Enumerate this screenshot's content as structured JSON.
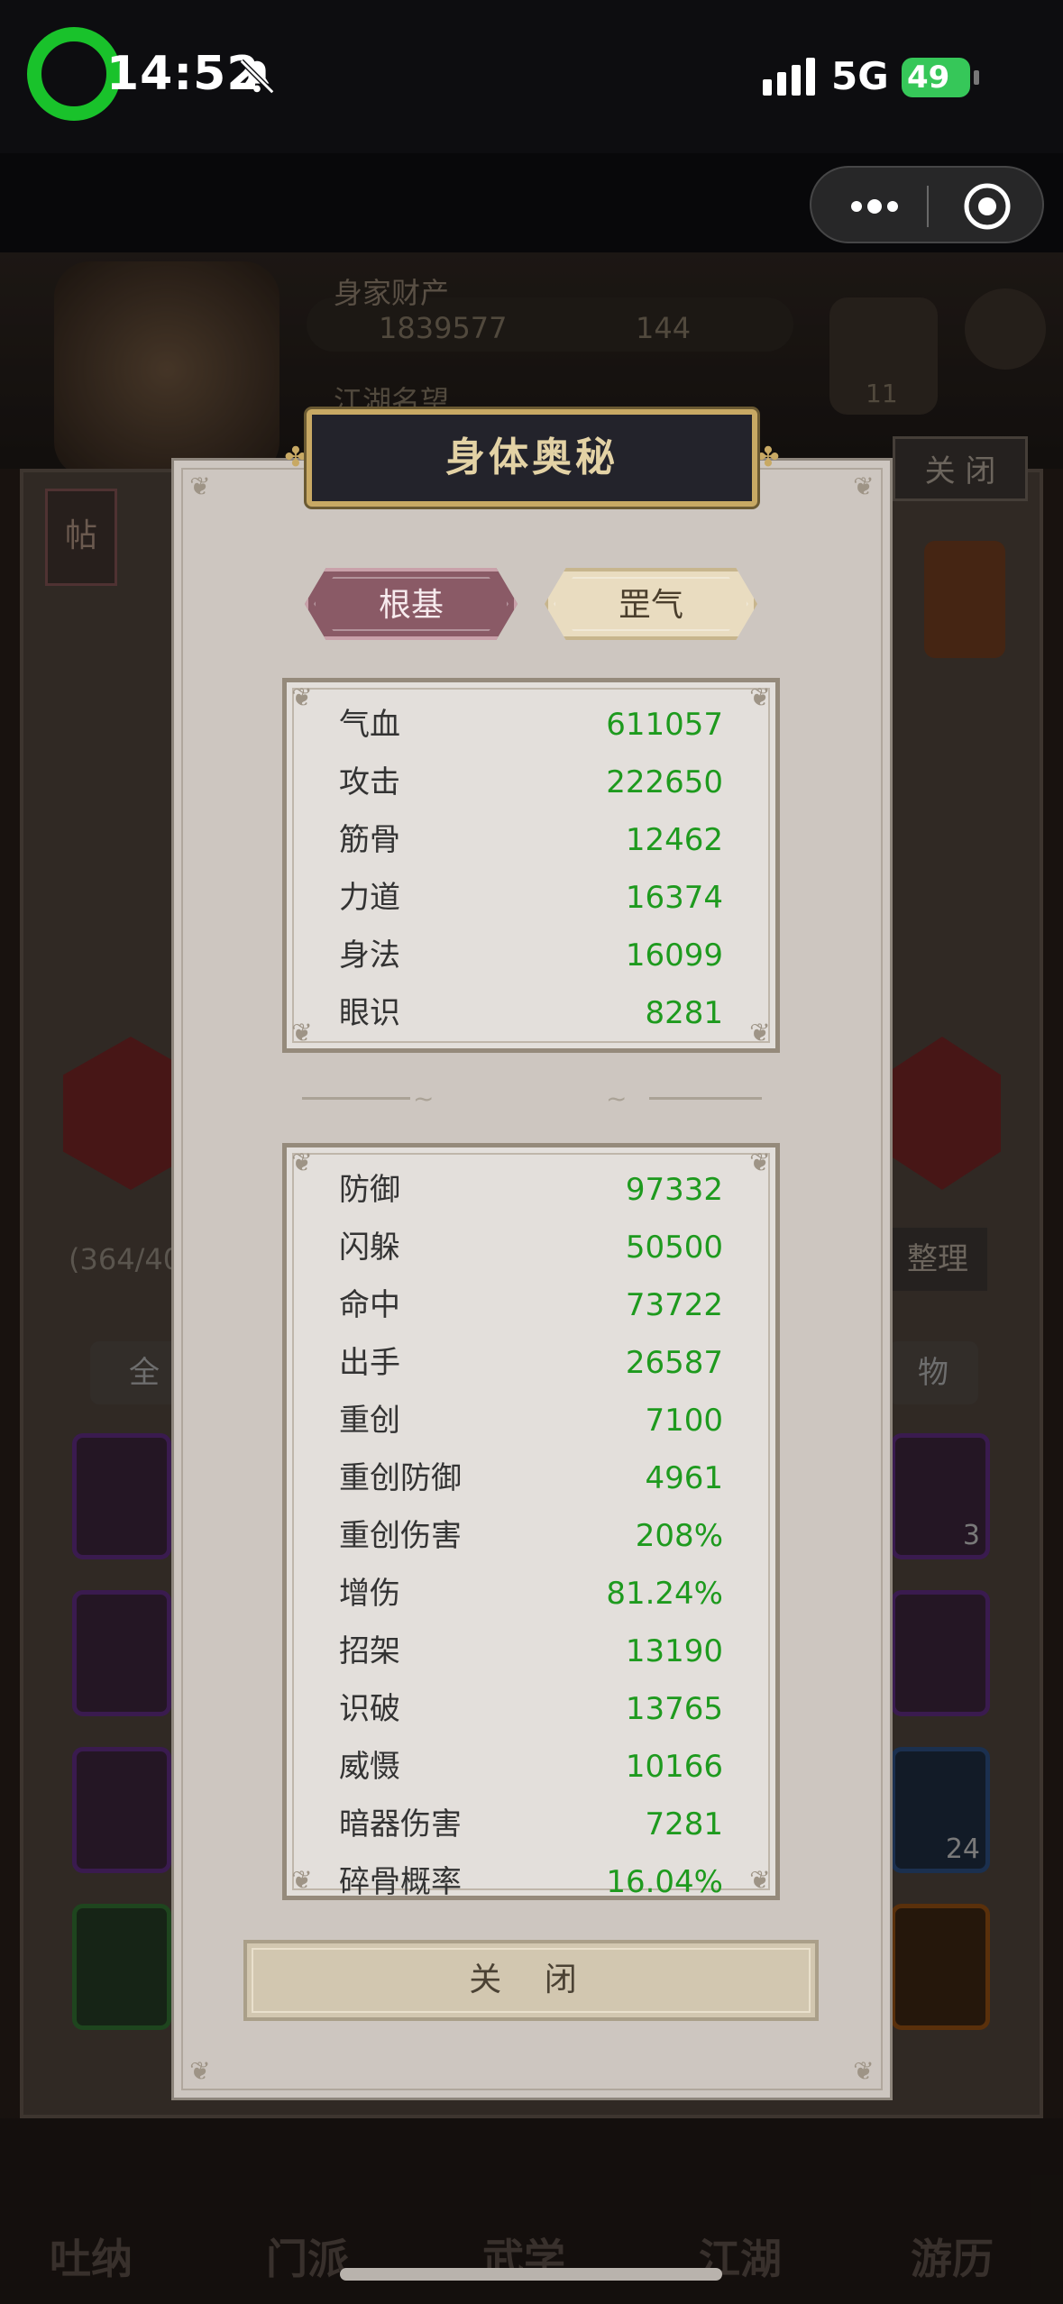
{
  "status_bar": {
    "time": "14:52",
    "network": "5G",
    "battery": "49",
    "icons": [
      "recording-icon",
      "bell-muted-icon",
      "signal-icon",
      "battery-charging-icon"
    ]
  },
  "capsule": {
    "icons": [
      "more-dots-icon",
      "close-target-icon"
    ]
  },
  "background": {
    "wealth_label": "身家财产",
    "gold": "1839577",
    "jade": "144",
    "fame_label": "江湖名望",
    "close_label": "关 闭",
    "post_label": "帖",
    "yinyang_count": "11",
    "inventory_count": "(364/40",
    "tidy_label": "整理",
    "tab_all": "全",
    "tab_items": "物",
    "slot_count_3": "3",
    "slot_count_24": "24",
    "nav": [
      "吐纳",
      "门派",
      "武学",
      "江湖",
      "游历"
    ]
  },
  "dialog": {
    "title": "身体奥秘",
    "tabs": [
      {
        "label": "根基",
        "active": true
      },
      {
        "label": "罡气",
        "active": false
      }
    ],
    "basic_stats": [
      {
        "label": "气血",
        "value": "611057"
      },
      {
        "label": "攻击",
        "value": "222650"
      },
      {
        "label": "筋骨",
        "value": "12462"
      },
      {
        "label": "力道",
        "value": "16374"
      },
      {
        "label": "身法",
        "value": "16099"
      },
      {
        "label": "眼识",
        "value": "8281"
      }
    ],
    "advanced_stats": [
      {
        "label": "防御",
        "value": "97332"
      },
      {
        "label": "闪躲",
        "value": "50500"
      },
      {
        "label": "命中",
        "value": "73722"
      },
      {
        "label": "出手",
        "value": "26587"
      },
      {
        "label": "重创",
        "value": "7100"
      },
      {
        "label": "重创防御",
        "value": "4961"
      },
      {
        "label": "重创伤害",
        "value": "208%"
      },
      {
        "label": "增伤",
        "value": "81.24%"
      },
      {
        "label": "招架",
        "value": "13190"
      },
      {
        "label": "识破",
        "value": "13765"
      },
      {
        "label": "威慑",
        "value": "10166"
      },
      {
        "label": "暗器伤害",
        "value": "7281"
      },
      {
        "label": "碎骨概率",
        "value": "16.04%"
      }
    ],
    "close_button": "关 闭"
  },
  "colors": {
    "value_green": "#1e9a1e",
    "tab_active": "#8a5a66",
    "title_gold": "#c8a964"
  }
}
